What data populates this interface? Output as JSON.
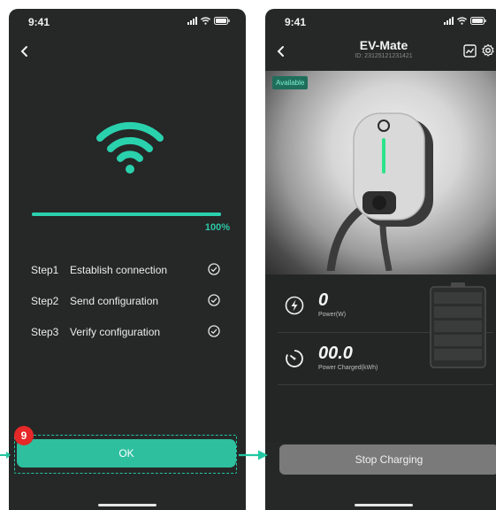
{
  "left_screen": {
    "status_time": "9:41",
    "progress": {
      "percent": 100,
      "label": "100%"
    },
    "steps": [
      {
        "no": "Step1",
        "text": "Establish connection"
      },
      {
        "no": "Step2",
        "text": "Send configuration"
      },
      {
        "no": "Step3",
        "text": "Verify configuration"
      }
    ],
    "ok_label": "OK"
  },
  "right_screen": {
    "status_time": "9:41",
    "title": "EV-Mate",
    "device_id": "ID: 23125121231421",
    "badge": "Available",
    "power": {
      "value": "0",
      "label": "Power(W)"
    },
    "charged": {
      "value": "00.0",
      "label": "Power Charged(kWh)"
    },
    "stop_label": "Stop Charging"
  },
  "annotation": {
    "step_number": "9"
  },
  "colors": {
    "accent": "#2ebf9f",
    "background": "#262727",
    "badge": "#e62828",
    "stop_button": "#7a7a7a"
  }
}
